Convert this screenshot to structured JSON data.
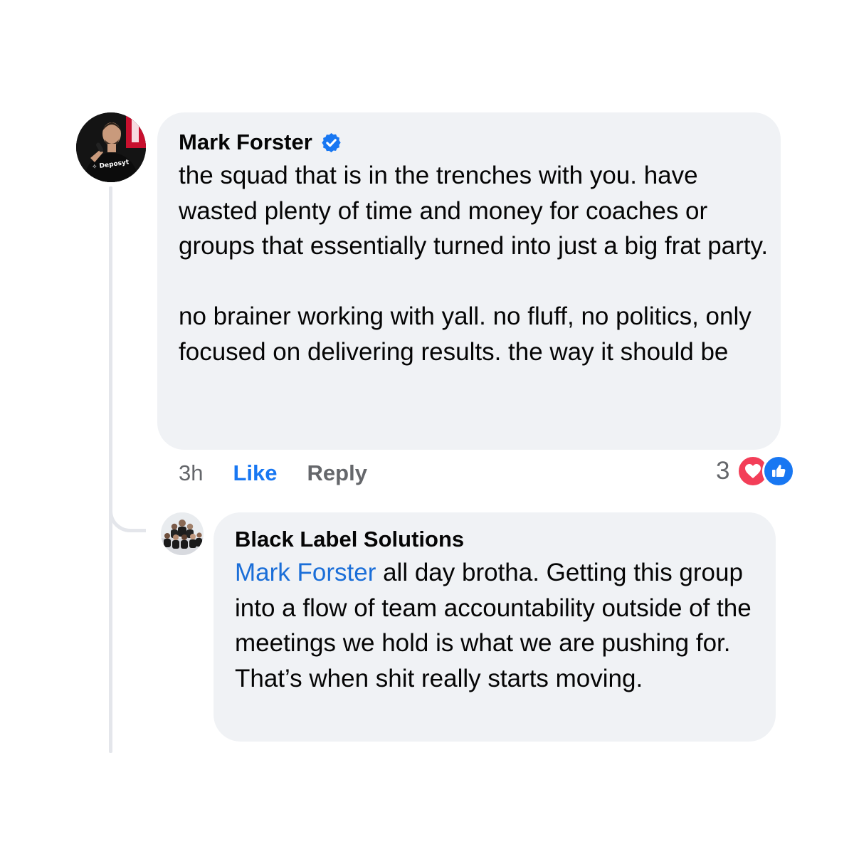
{
  "comment": {
    "author": "Mark Forster",
    "verified": true,
    "text": "the squad that is in the trenches with you. have wasted plenty of time and money for coaches or groups that essentially turned into just a big frat party.\n\nno brainer working with yall. no fluff, no politics, only focused on delivering results. the way it should be",
    "avatar_shirt_text": "✧ Deposyt",
    "time": "3h",
    "like_label": "Like",
    "reply_label": "Reply",
    "reaction_count": "3",
    "reaction_icons": [
      "love-icon",
      "like-thumb-icon"
    ]
  },
  "reply": {
    "author": "Black Label Solutions",
    "mention": "Mark Forster",
    "text": " all day brotha. Getting this group into a flow of team accountability outside of the meetings we hold is what we are pushing for. That’s when shit really starts moving."
  },
  "colors": {
    "bubble": "#f0f2f5",
    "link_blue": "#1877f2",
    "mention_blue": "#1a6ed8",
    "meta_gray": "#65676b",
    "love_red": "#f33e58",
    "thread_line": "#e4e6eb"
  }
}
